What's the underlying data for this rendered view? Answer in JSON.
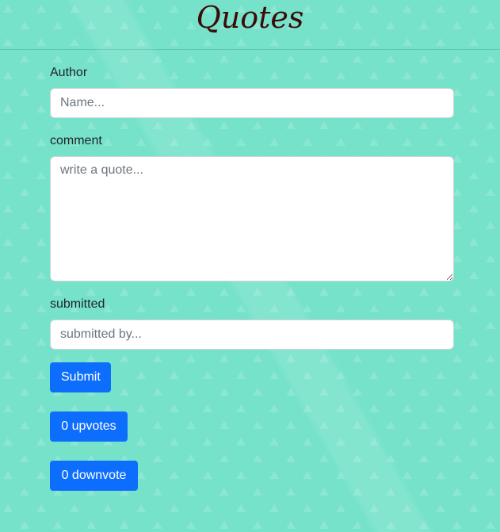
{
  "header": {
    "title": "Quotes"
  },
  "form": {
    "author_label": "Author",
    "author_placeholder": "Name...",
    "comment_label": "comment",
    "comment_placeholder": "write a quote...",
    "submitted_label": "submitted",
    "submitted_placeholder": "submitted by...",
    "submit_button": "Submit"
  },
  "votes": {
    "upvotes_button": "0 upvotes",
    "downvote_button": "0 downvote"
  },
  "colors": {
    "background": "#75e2c9",
    "title": "#3d0a0a",
    "button": "#0d6efd"
  }
}
